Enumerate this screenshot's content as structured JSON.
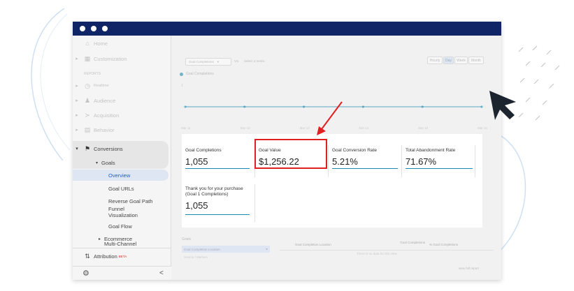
{
  "sidebar": {
    "items": [
      {
        "label": "Home",
        "icon": "home-icon"
      },
      {
        "label": "Customization",
        "icon": "customization-icon"
      },
      {
        "label": "REPORTS",
        "icon": ""
      },
      {
        "label": "Realtime",
        "icon": "clock-icon"
      },
      {
        "label": "Audience",
        "icon": "person-icon"
      },
      {
        "label": "Acquisition",
        "icon": "acquisition-icon"
      },
      {
        "label": "Behavior",
        "icon": "behavior-icon"
      },
      {
        "label": "Conversions",
        "icon": "flag-icon"
      },
      {
        "label": "Goals",
        "icon": ""
      },
      {
        "label": "Overview",
        "icon": ""
      },
      {
        "label": "Goal URLs",
        "icon": ""
      },
      {
        "label": "Reverse Goal Path",
        "icon": ""
      },
      {
        "label": "Funnel Visualization",
        "icon": ""
      },
      {
        "label": "Goal Flow",
        "icon": ""
      },
      {
        "label": "Ecommerce",
        "icon": ""
      },
      {
        "label": "Multi-Channel",
        "icon": ""
      },
      {
        "label": "Attribution",
        "icon": "attribution-icon",
        "badge": "BETA"
      }
    ],
    "collapse_label": "<"
  },
  "toolbar": {
    "dropdown": "Goal Completions",
    "vs_label": "VS.",
    "select_metric": "Select a metric",
    "time_buttons": [
      "Hourly",
      "Day",
      "Week",
      "Month"
    ],
    "series_label": "Goal Completions"
  },
  "chart_data": {
    "type": "line",
    "x": [
      "Mar 11",
      "Mar 12",
      "Mar 13",
      "Mar 14",
      "Mar 15",
      "Mar 16"
    ],
    "series": [
      {
        "name": "Goal Completions",
        "values": [
          1,
          1,
          1,
          1,
          1,
          1
        ]
      }
    ]
  },
  "metrics": [
    {
      "label": "Goal Completions",
      "value": "1,055"
    },
    {
      "label": "Goal Value",
      "value": "$1,256.22"
    },
    {
      "label": "Goal Conversion Rate",
      "value": "5.21%"
    },
    {
      "label": "Total Abandonment Rate",
      "value": "71.67%"
    },
    {
      "label": "Thank you for your purchase (Goal 1 Completions)",
      "value": "1,055"
    }
  ],
  "table": {
    "goals_label": "Goals",
    "row_selected": "Goal Completion Location",
    "row_other": "Source / Medium",
    "col1": "Goal Completion Location",
    "col2": "Goal Completions",
    "col3": "% Goal Completions",
    "empty": "There is no data for this view.",
    "view_full": "view full report"
  },
  "colors": {
    "titlebar": "#0f2566",
    "accent": "#1a8bb0",
    "highlight": "#e02020"
  }
}
